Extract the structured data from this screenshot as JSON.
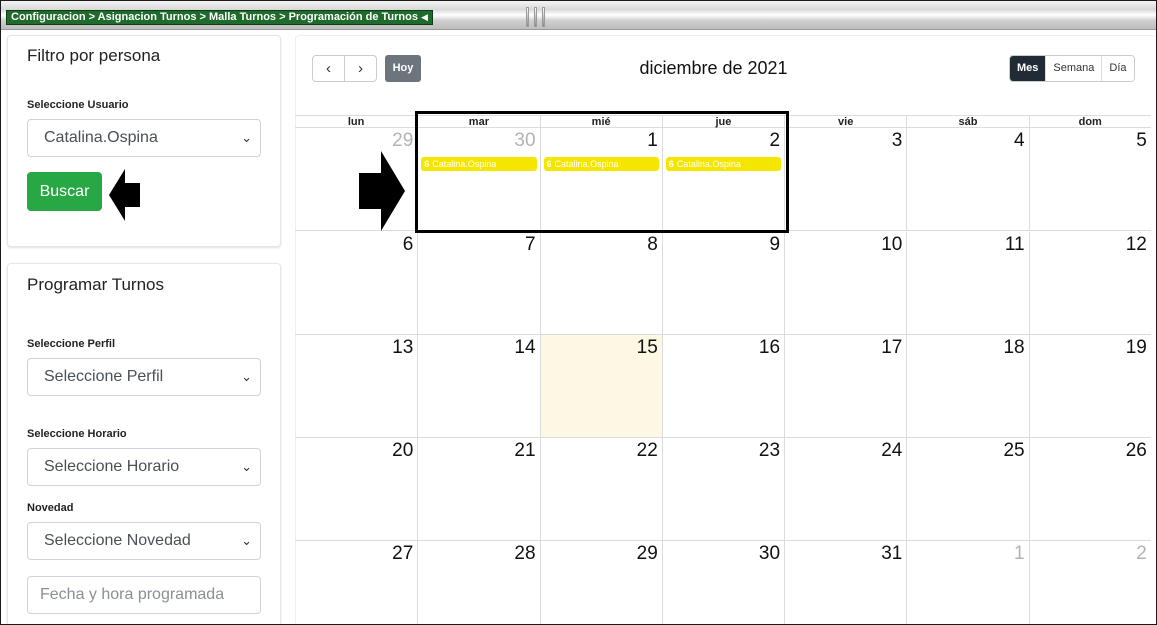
{
  "breadcrumb": {
    "text": "Configuracion > Asignacion Turnos > Malla Turnos > Programación de Turnos",
    "tri": "◀"
  },
  "filter": {
    "title": "Filtro por persona",
    "user_label": "Seleccione Usuario",
    "user_value": "Catalina.Ospina",
    "search_button": "Buscar"
  },
  "program": {
    "title": "Programar Turnos",
    "profile_label": "Seleccione Perfil",
    "profile_value": "Seleccione Perfil",
    "schedule_label": "Seleccione Horario",
    "schedule_value": "Seleccione Horario",
    "novelty_label": "Novedad",
    "novelty_value": "Seleccione Novedad",
    "datetime_placeholder": "Fecha y hora programada"
  },
  "calendar": {
    "prev": "‹",
    "next": "›",
    "today_button": "Hoy",
    "title": "diciembre de 2021",
    "views": [
      "Mes",
      "Semana",
      "Día"
    ],
    "active_view": "Mes",
    "weekdays": [
      "lun",
      "mar",
      "mié",
      "jue",
      "vie",
      "sáb",
      "dom"
    ],
    "weeks": [
      [
        "29",
        "30",
        "1",
        "2",
        "3",
        "4",
        "5"
      ],
      [
        "6",
        "7",
        "8",
        "9",
        "10",
        "11",
        "12"
      ],
      [
        "13",
        "14",
        "15",
        "16",
        "17",
        "18",
        "19"
      ],
      [
        "20",
        "21",
        "22",
        "23",
        "24",
        "25",
        "26"
      ],
      [
        "27",
        "28",
        "29",
        "30",
        "31",
        "1",
        "2"
      ]
    ],
    "events": {
      "tue": {
        "time": "6",
        "name": "Catalina.Ospina"
      },
      "wed": {
        "time": "6",
        "name": "Catalina.Ospina"
      },
      "thu": {
        "time": "6",
        "name": "Catalina.Ospina"
      }
    }
  }
}
